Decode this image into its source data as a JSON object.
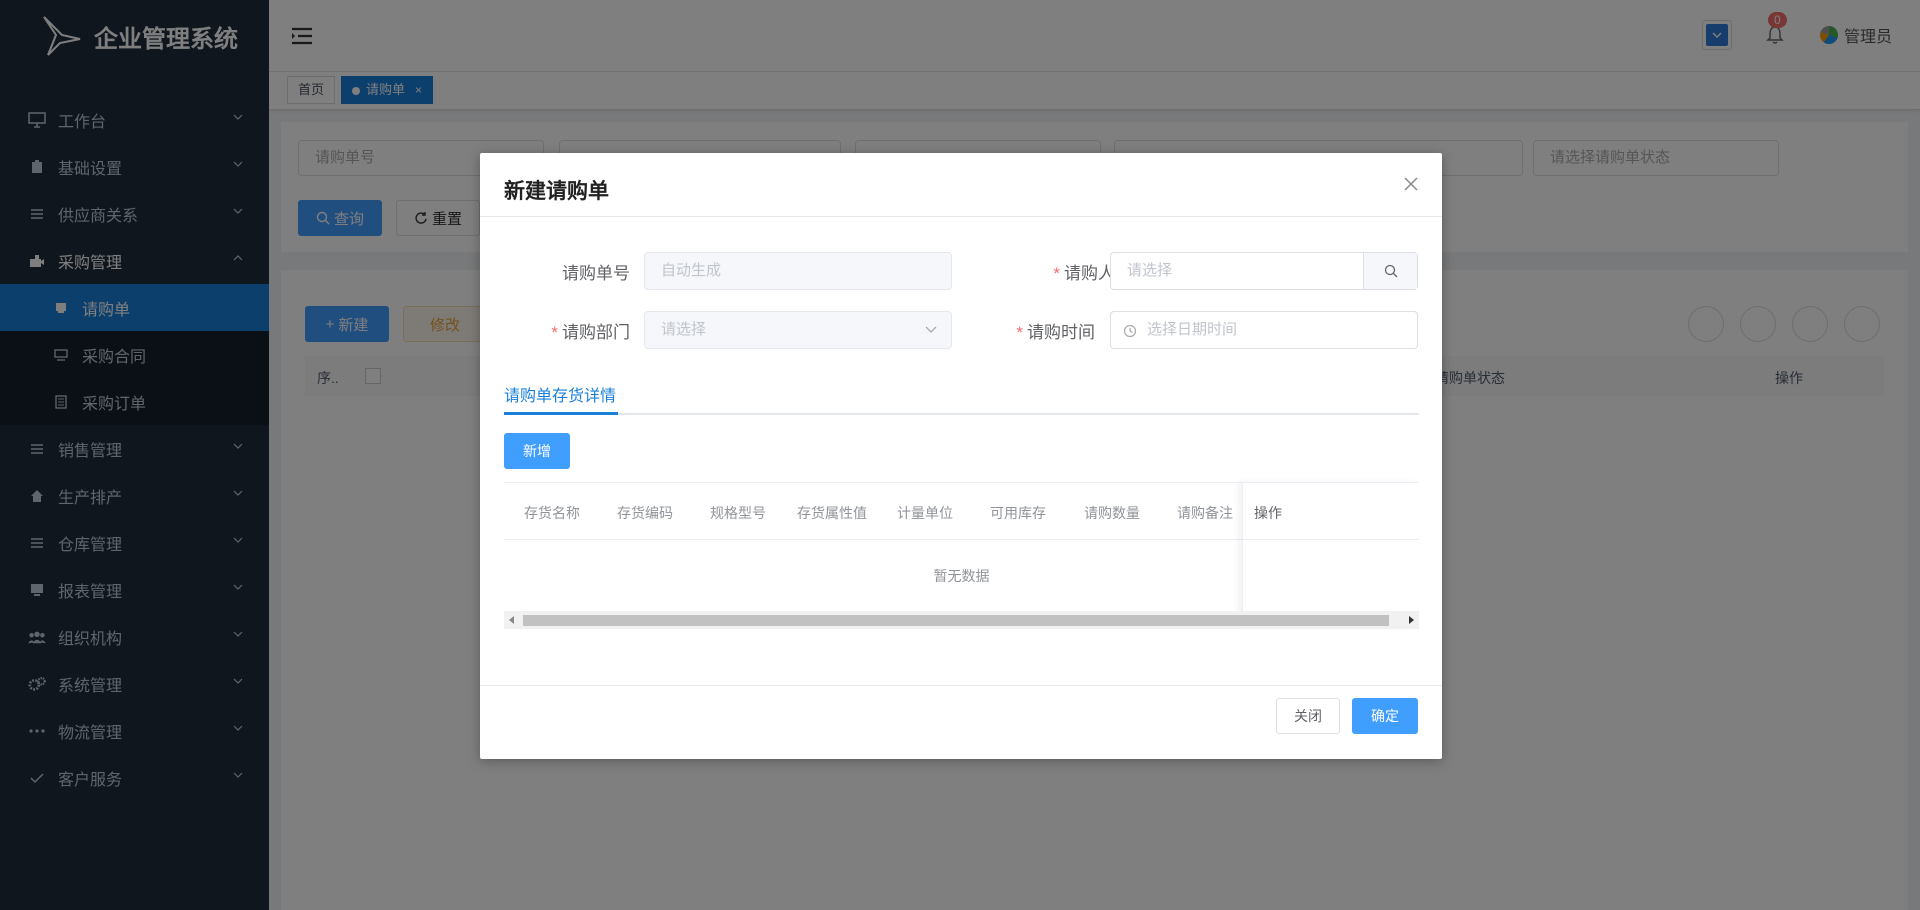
{
  "app": {
    "title": "企业管理系统"
  },
  "sidebar": {
    "items": [
      {
        "label": "工作台",
        "icon": "monitor-icon"
      },
      {
        "label": "基础设置",
        "icon": "clipboard-icon"
      },
      {
        "label": "供应商关系",
        "icon": "list-icon"
      },
      {
        "label": "采购管理",
        "icon": "cart-icon",
        "open": true,
        "children": [
          {
            "label": "请购单",
            "icon": "doc-icon",
            "active": true
          },
          {
            "label": "采购合同",
            "icon": "contract-icon"
          },
          {
            "label": "采购订单",
            "icon": "order-icon"
          }
        ]
      },
      {
        "label": "销售管理",
        "icon": "list-icon"
      },
      {
        "label": "生产排产",
        "icon": "home-icon"
      },
      {
        "label": "仓库管理",
        "icon": "list-icon"
      },
      {
        "label": "报表管理",
        "icon": "report-icon"
      },
      {
        "label": "组织机构",
        "icon": "people-icon"
      },
      {
        "label": "系统管理",
        "icon": "gears-icon"
      },
      {
        "label": "物流管理",
        "icon": "dots-icon"
      },
      {
        "label": "客户服务",
        "icon": "check-icon"
      }
    ]
  },
  "header": {
    "notification_count": "0",
    "user_name": "管理员"
  },
  "tags": {
    "home": "首页",
    "current": "请购单",
    "close": "×"
  },
  "search": {
    "order_no_placeholder": "请购单号",
    "status_placeholder": "请选择请购单状态",
    "query_label": "查询",
    "reset_label": "重置"
  },
  "toolbar": {
    "new_label": "新建",
    "edit_label": "修改"
  },
  "main_table": {
    "col_index": "序..",
    "col_status": "请购单状态",
    "col_action": "操作"
  },
  "dialog": {
    "title": "新建请购单",
    "fields": {
      "order_no_label": "请购单号",
      "order_no_placeholder": "自动生成",
      "requester_label": "请购人",
      "requester_placeholder": "请选择",
      "dept_label": "请购部门",
      "dept_placeholder": "请选择",
      "time_label": "请购时间",
      "time_placeholder": "选择日期时间",
      "required_mark": "*"
    },
    "tab_label": "请购单存货详情",
    "add_label": "新增",
    "columns": [
      "存货名称",
      "存货编码",
      "规格型号",
      "存货属性值",
      "计量单位",
      "可用库存",
      "请购数量",
      "请购备注",
      "操作"
    ],
    "empty_text": "暂无数据",
    "close_label": "关闭",
    "confirm_label": "确定"
  },
  "colors": {
    "primary": "#409eff",
    "sidebar_bg": "#1f2d3d",
    "active_menu": "#1a7fd9"
  }
}
